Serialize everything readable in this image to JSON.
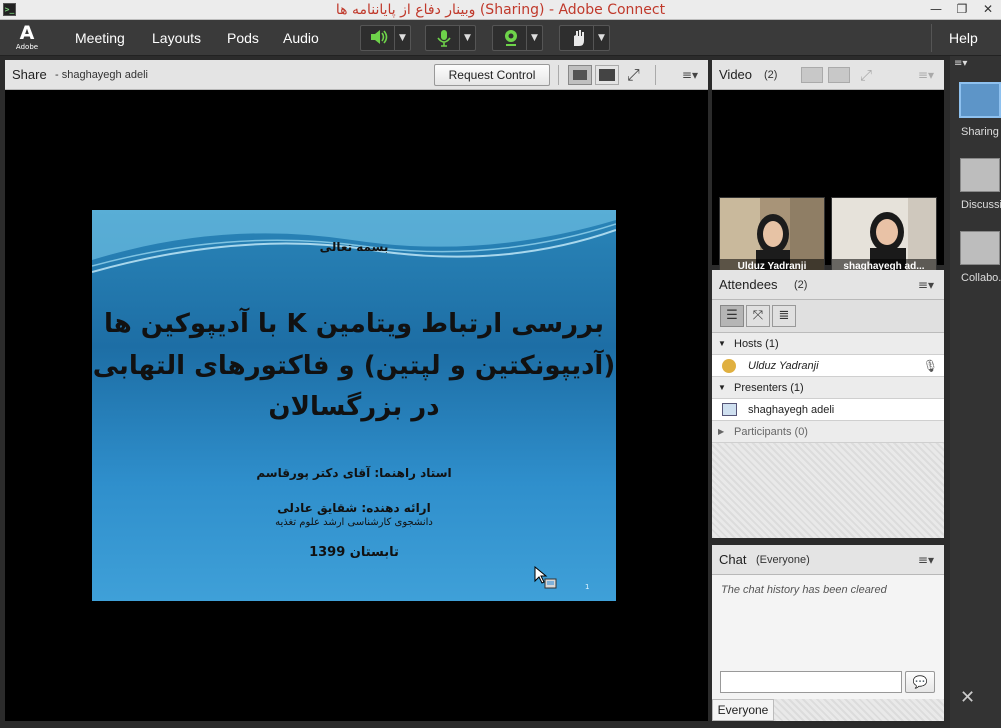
{
  "window": {
    "title": "وبینار دفاع از پایاننامه ها (Sharing) - Adobe Connect",
    "app_icon": "terminal-icon",
    "minimize": "—",
    "restore": "❐",
    "close": "✕"
  },
  "menubar": {
    "logo_text": "Adobe",
    "items": [
      "Meeting",
      "Layouts",
      "Pods",
      "Audio"
    ],
    "help": "Help",
    "speaker_icon": "speaker-icon",
    "mic_icon": "microphone-icon",
    "camera_icon": "webcam-icon",
    "status_icon": "raise-hand-icon"
  },
  "share_pod": {
    "title": "Share",
    "subtitle": "- shaghayegh adeli",
    "request_control": "Request Control",
    "menu_icon": "≡▾"
  },
  "slide": {
    "header": "بسمه تعالی",
    "title_line1": "بررسی ارتباط ویتامین K با آدیپوکین ها",
    "title_line2": "(آدیپونکتین و لپتین) و فاکتورهای التهابی",
    "title_line3": "در بزرگسالان",
    "advisor": "استاد راهنما: آقای دکتر پورقاسم",
    "presenter": "ارائه دهنده: شقایق عادلی",
    "presenter_sub": "دانشجوی کارشناسی ارشد علوم تغذیه",
    "date": "تابستان 1399",
    "page_number": "1"
  },
  "video_pod": {
    "title": "Video",
    "count": "(2)",
    "participants": [
      "Ulduz Yadranji",
      "shaghayegh ad..."
    ]
  },
  "attendees_pod": {
    "title": "Attendees",
    "count": "(2)",
    "hosts_label": "Hosts (1)",
    "host_name": "Ulduz Yadranji",
    "presenters_label": "Presenters (1)",
    "presenter_name": "shaghayegh adeli",
    "participants_label": "Participants (0)"
  },
  "chat_pod": {
    "title": "Chat",
    "scope": "(Everyone)",
    "history_message": "The chat history has been cleared",
    "input_placeholder": "",
    "recipient": "Everyone"
  },
  "layouts_bar": {
    "items": [
      "Sharing",
      "Discussi",
      "Collabo."
    ]
  }
}
